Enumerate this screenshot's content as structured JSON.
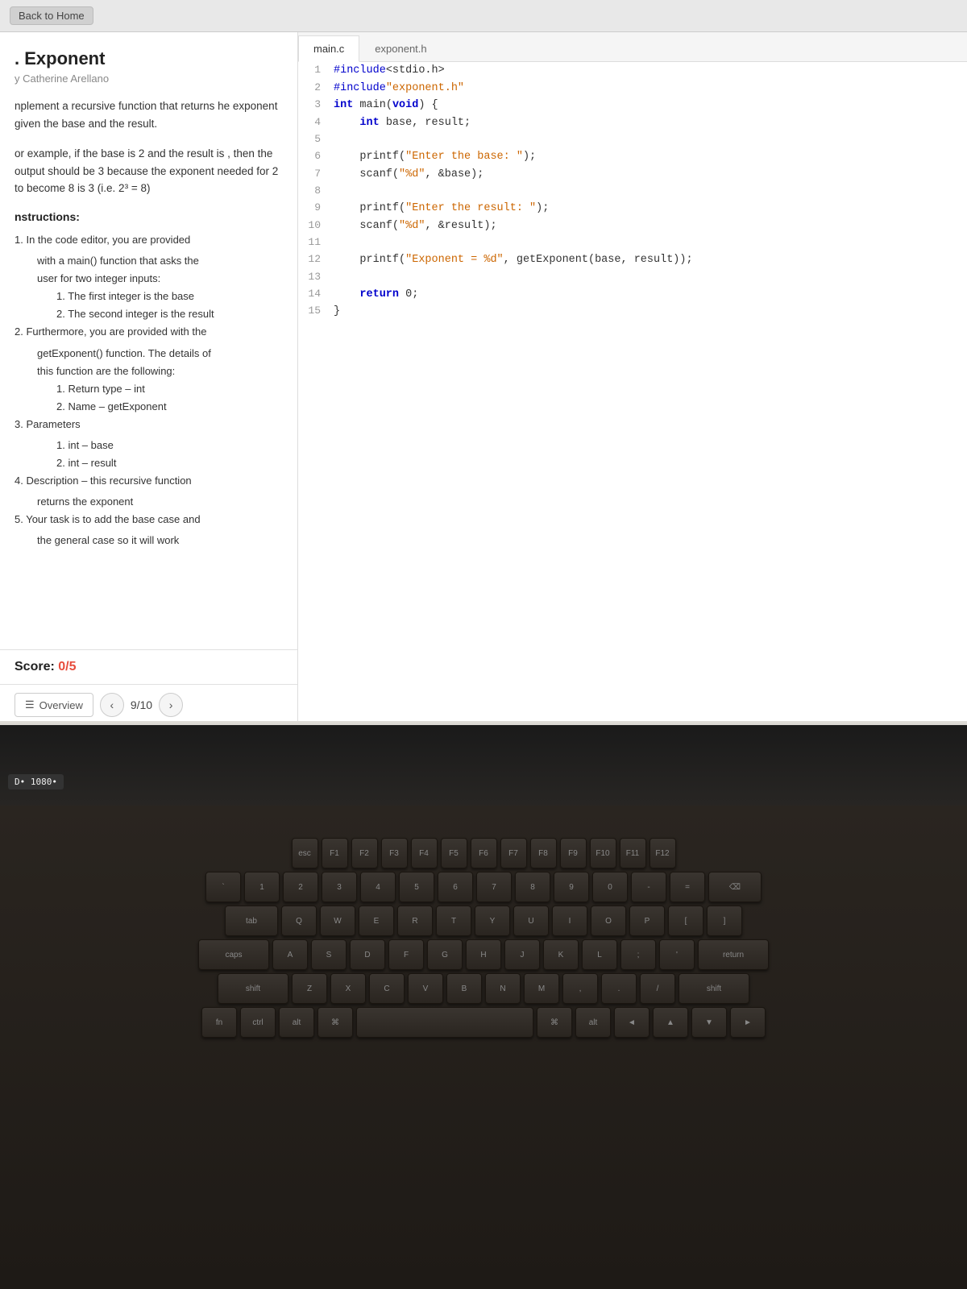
{
  "nav": {
    "back_label": "Back to Home"
  },
  "problem": {
    "title": ". Exponent",
    "author": "y Catherine Arellano",
    "description1": "nplement a recursive function that returns\nhe exponent given the base and the result.",
    "description2": "or example, if the base is 2 and the result is\n, then the output should be 3 because the\nexponent needed for 2 to become 8 is 3 (i.e.\n2³ = 8)",
    "instructions_header": "nstructions:",
    "instructions": [
      {
        "level": 1,
        "text": "1. In the code editor, you are provided"
      },
      {
        "level": 2,
        "text": "with a main() function that asks the"
      },
      {
        "level": 2,
        "text": "user for two integer inputs:"
      },
      {
        "level": 3,
        "text": "1. The first integer is the base"
      },
      {
        "level": 3,
        "text": "2. The second integer is the result"
      },
      {
        "level": 1,
        "text": "2. Furthermore, you are provided with the"
      },
      {
        "level": 2,
        "text": "getExponent() function. The details of"
      },
      {
        "level": 2,
        "text": "this function are the following:"
      },
      {
        "level": 3,
        "text": "1. Return type – int"
      },
      {
        "level": 3,
        "text": "2. Name – getExponent"
      },
      {
        "level": 1,
        "text": "3. Parameters"
      },
      {
        "level": 3,
        "text": "1. int – base"
      },
      {
        "level": 3,
        "text": "2. int – result"
      },
      {
        "level": 1,
        "text": "4. Description – this recursive function"
      },
      {
        "level": 2,
        "text": "returns the exponent"
      },
      {
        "level": 1,
        "text": "5. Your task is to add the base case and"
      },
      {
        "level": 2,
        "text": "the general case so it will work"
      }
    ]
  },
  "score": {
    "label": "Score: ",
    "value": "0/5"
  },
  "bottom_nav": {
    "overview_label": "Overview",
    "page": "9/10"
  },
  "editor": {
    "tabs": [
      {
        "id": "main",
        "label": "main.c",
        "active": true
      },
      {
        "id": "exponent",
        "label": "exponent.h",
        "active": false
      }
    ],
    "lines": [
      {
        "num": "1",
        "code": "#include<stdio.h>"
      },
      {
        "num": "2",
        "code": "#include\"exponent.h\""
      },
      {
        "num": "3",
        "code": "int main(void) {"
      },
      {
        "num": "4",
        "code": "    int base, result;"
      },
      {
        "num": "5",
        "code": ""
      },
      {
        "num": "6",
        "code": "    printf(\"Enter the base: \");"
      },
      {
        "num": "7",
        "code": "    scanf(\"%d\", &base);"
      },
      {
        "num": "8",
        "code": ""
      },
      {
        "num": "9",
        "code": "    printf(\"Enter the result: \");"
      },
      {
        "num": "10",
        "code": "    scanf(\"%d\", &result);"
      },
      {
        "num": "11",
        "code": ""
      },
      {
        "num": "12",
        "code": "    printf(\"Exponent = %d\", getExponent(base, result));"
      },
      {
        "num": "13",
        "code": ""
      },
      {
        "num": "14",
        "code": "    return 0;"
      },
      {
        "num": "15",
        "code": "}"
      }
    ]
  },
  "keyboard": {
    "rows": [
      [
        "Q",
        "W",
        "E",
        "R",
        "T",
        "Y",
        "U",
        "I",
        "O",
        "P"
      ],
      [
        "A",
        "S",
        "D",
        "F",
        "G",
        "H",
        "J",
        "K",
        "L"
      ],
      [
        "Z",
        "X",
        "C",
        "V",
        "B",
        "N",
        "M"
      ]
    ]
  },
  "resolution": "D• 1080•"
}
